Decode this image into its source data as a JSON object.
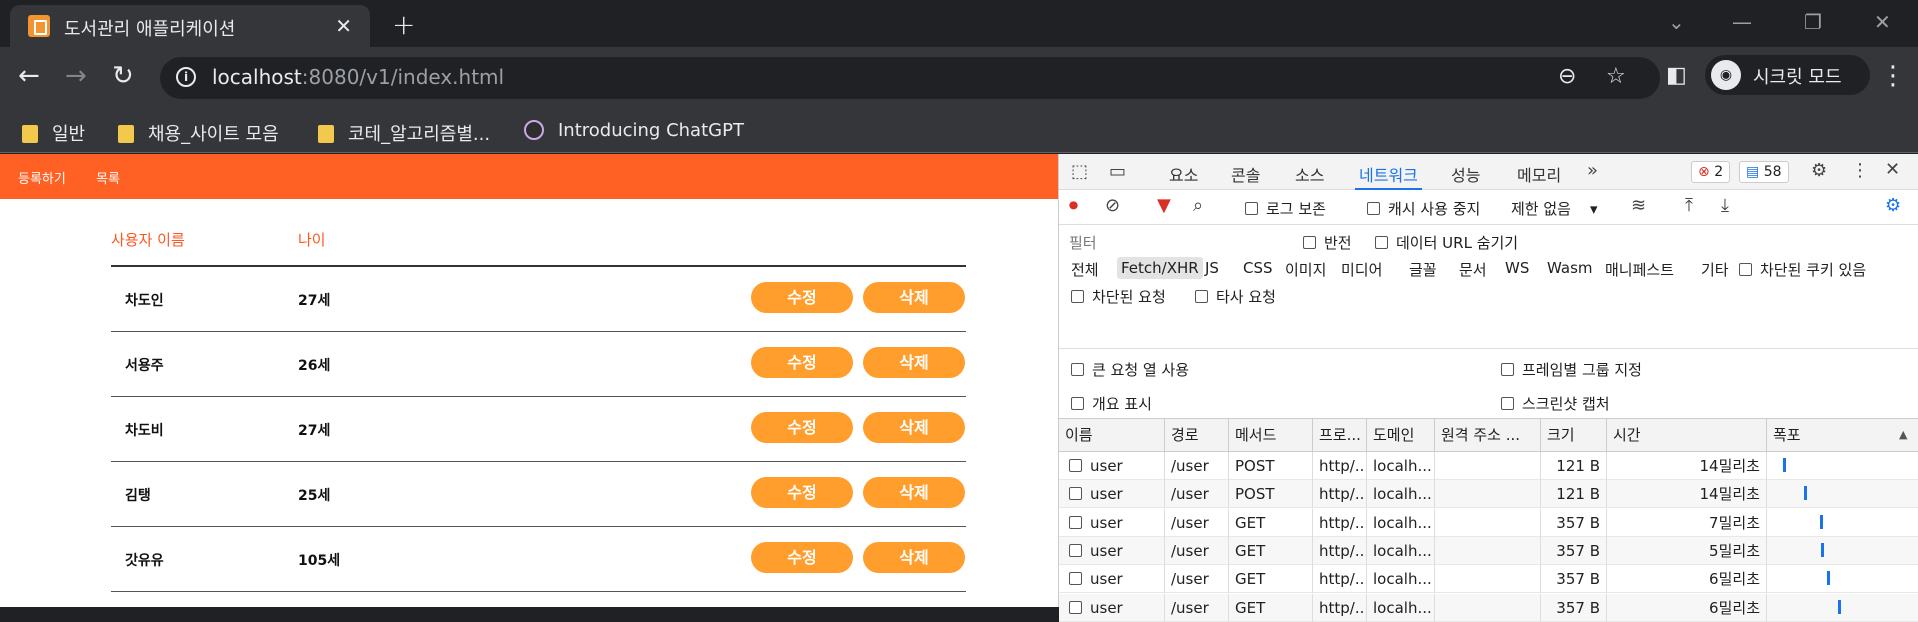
{
  "browser": {
    "tab_title": "도서관리 애플리케이션",
    "url_host": "localhost",
    "url_rest": ":8080/v1/index.html",
    "profile_label": "시크릿 모드",
    "bookmarks": [
      "일반",
      "채용_사이트 모음",
      "코테_알고리즘별...",
      "Introducing ChatGPT"
    ]
  },
  "app": {
    "nav": {
      "register": "등록하기",
      "list": "목록"
    },
    "columns": {
      "name": "사용자 이름",
      "age": "나이"
    },
    "users": [
      {
        "name": "차도인",
        "age": "27세"
      },
      {
        "name": "서용주",
        "age": "26세"
      },
      {
        "name": "차도비",
        "age": "27세"
      },
      {
        "name": "김탱",
        "age": "25세"
      },
      {
        "name": "갓유유",
        "age": "105세"
      }
    ],
    "edit_label": "수정",
    "delete_label": "삭제"
  },
  "devtools": {
    "tabs": [
      "요소",
      "콘솔",
      "소스",
      "네트워크",
      "성능",
      "메모리"
    ],
    "active_tab": "네트워크",
    "error_count": "2",
    "message_count": "58",
    "toolbar": {
      "preserve_log": "로그 보존",
      "disable_cache": "캐시 사용 중지",
      "throttle": "제한 없음"
    },
    "filter": {
      "placeholder": "필터",
      "invert": "반전",
      "hide_data_urls": "데이터 URL 숨기기",
      "types": [
        "전체",
        "Fetch/XHR",
        "JS",
        "CSS",
        "이미지",
        "미디어",
        "글꼴",
        "문서",
        "WS",
        "Wasm",
        "매니페스트",
        "기타"
      ],
      "selected_type": "Fetch/XHR",
      "blocked_cookies": "차단된 쿠키 있음",
      "blocked_requests": "차단된 요청",
      "third_party": "타사 요청"
    },
    "options": {
      "big_rows": "큰 요청 열 사용",
      "group_by_frame": "프레임별 그룹 지정",
      "overview": "개요 표시",
      "screenshots": "스크린샷 캡처"
    },
    "grid_columns": [
      "이름",
      "경로",
      "메서드",
      "프로...",
      "도메인",
      "원격 주소 ...",
      "크기",
      "시간",
      "폭포"
    ],
    "requests": [
      {
        "name": "user",
        "path": "/user",
        "method": "POST",
        "proto": "http/...",
        "domain": "localh...",
        "remote": "",
        "size": "121 B",
        "time": "14밀리초",
        "wf": 0.08
      },
      {
        "name": "user",
        "path": "/user",
        "method": "POST",
        "proto": "http/...",
        "domain": "localh...",
        "remote": "",
        "size": "121 B",
        "time": "14밀리초",
        "wf": 0.22
      },
      {
        "name": "user",
        "path": "/user",
        "method": "GET",
        "proto": "http/...",
        "domain": "localh...",
        "remote": "",
        "size": "357 B",
        "time": "7밀리초",
        "wf": 0.32
      },
      {
        "name": "user",
        "path": "/user",
        "method": "GET",
        "proto": "http/...",
        "domain": "localh...",
        "remote": "",
        "size": "357 B",
        "time": "5밀리초",
        "wf": 0.33
      },
      {
        "name": "user",
        "path": "/user",
        "method": "GET",
        "proto": "http/...",
        "domain": "localh...",
        "remote": "",
        "size": "357 B",
        "time": "6밀리초",
        "wf": 0.37
      },
      {
        "name": "user",
        "path": "/user",
        "method": "GET",
        "proto": "http/...",
        "domain": "localh...",
        "remote": "",
        "size": "357 B",
        "time": "6밀리초",
        "wf": 0.44
      }
    ]
  }
}
